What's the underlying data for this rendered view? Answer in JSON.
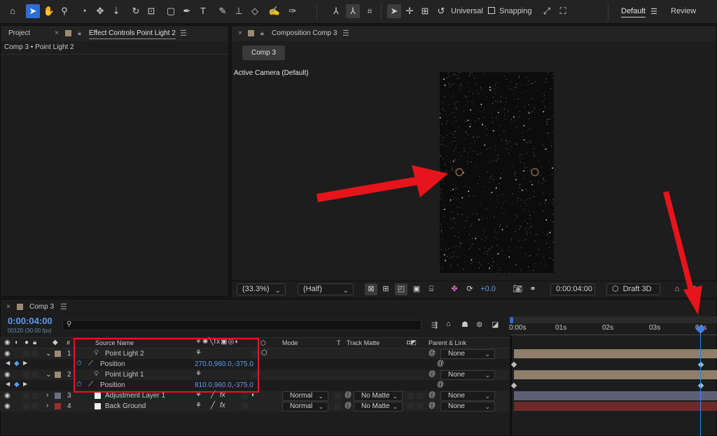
{
  "toolbar": {
    "universal_label": "Universal",
    "snapping_label": "Snapping",
    "workspace_default": "Default",
    "workspace_review": "Review"
  },
  "project_panel": {
    "tab_project": "Project",
    "tab_effect_controls": "Effect Controls Point Light 2",
    "breadcrumb": "Comp 3 • Point Light 2"
  },
  "composition_panel": {
    "tab_label": "Composition Comp 3",
    "comp_chip": "Comp 3",
    "camera_label": "Active Camera (Default)",
    "zoom": "(33.3%)",
    "resolution": "(Half)",
    "exposure": "+0.0",
    "timecode": "0:00:04:00",
    "renderer": "Draft 3D"
  },
  "timeline": {
    "tab_label": "Comp 3",
    "current_time": "0:00:04:00",
    "frame_info": "00120 (30.00 fps)",
    "search_placeholder": "",
    "headers": {
      "hash": "#",
      "source_name": "Source Name",
      "mode": "Mode",
      "t": "T",
      "track_matte": "Track Matte",
      "parent_link": "Parent & Link"
    },
    "ruler": [
      "0:00s",
      "01s",
      "02s",
      "03s",
      "04s"
    ],
    "layers": [
      {
        "num": "1",
        "name": "Point Light 2",
        "parent": "None"
      },
      {
        "property": "Position",
        "value": "270.0,960.0,-375.0"
      },
      {
        "num": "2",
        "name": "Point Light 1",
        "parent": "None"
      },
      {
        "property": "Position",
        "value": "810.0,960.0,-375.0"
      },
      {
        "num": "3",
        "name": "Adjustment Layer 1",
        "mode": "Normal",
        "matte": "No Matte",
        "parent": "None"
      },
      {
        "num": "4",
        "name": "Back Ground",
        "mode": "Normal",
        "matte": "No Matte",
        "parent": "None"
      }
    ]
  },
  "colors": {
    "accent_blue": "#2d6fd6",
    "annotation_red": "#e8141b",
    "light_layer": "#9c8a74",
    "adjustment_layer": "#6c6f85",
    "background_layer": "#7c2f2f"
  }
}
